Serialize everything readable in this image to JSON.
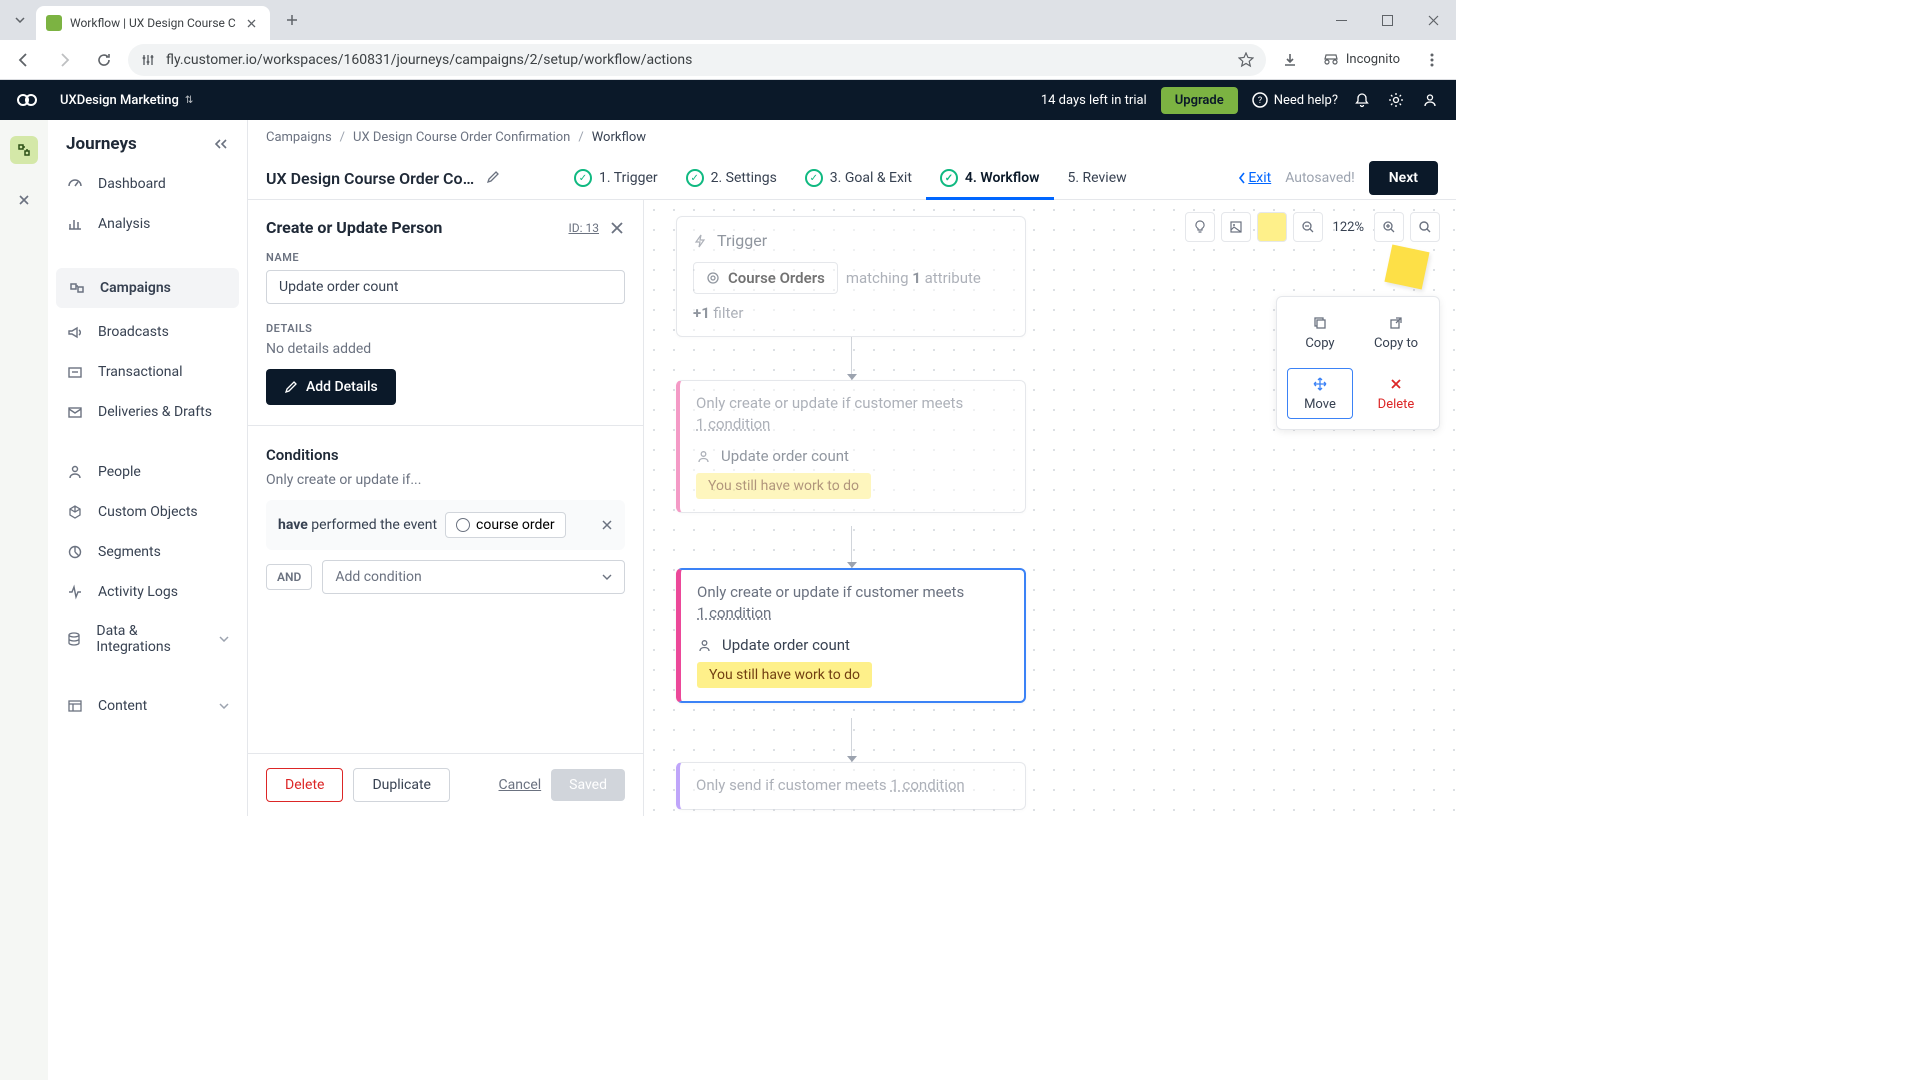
{
  "browser": {
    "tab_title": "Workflow | UX Design Course C",
    "url": "fly.customer.io/workspaces/160831/journeys/campaigns/2/setup/workflow/actions",
    "incognito": "Incognito"
  },
  "header": {
    "workspace": "UXDesign Marketing",
    "trial": "14 days left in trial",
    "upgrade": "Upgrade",
    "help": "Need help?"
  },
  "sidebar": {
    "title": "Journeys",
    "items": [
      "Dashboard",
      "Analysis",
      "Campaigns",
      "Broadcasts",
      "Transactional",
      "Deliveries & Drafts",
      "People",
      "Custom Objects",
      "Segments",
      "Activity Logs",
      "Data & Integrations",
      "Content"
    ]
  },
  "breadcrumb": {
    "a": "Campaigns",
    "b": "UX Design Course Order Confirmation",
    "c": "Workflow"
  },
  "workflow": {
    "title": "UX Design Course Order Confir…",
    "steps": [
      "1. Trigger",
      "2. Settings",
      "3. Goal & Exit",
      "4. Workflow",
      "5. Review"
    ],
    "exit": "Exit",
    "autosaved": "Autosaved!",
    "next": "Next"
  },
  "panel": {
    "title": "Create or Update Person",
    "id": "ID: 13",
    "name_label": "NAME",
    "name_value": "Update order count",
    "details_label": "DETAILS",
    "details_text": "No details added",
    "add_details": "Add Details",
    "conditions_title": "Conditions",
    "conditions_subtitle": "Only create or update if...",
    "have": "have",
    "performed": "performed the event",
    "event_name": "course order",
    "and": "AND",
    "add_condition": "Add condition",
    "delete": "Delete",
    "duplicate": "Duplicate",
    "cancel": "Cancel",
    "saved": "Saved"
  },
  "canvas": {
    "zoom": "122%",
    "actions": {
      "copy": "Copy",
      "copy_to": "Copy to",
      "move": "Move",
      "delete": "Delete"
    },
    "trigger": {
      "label": "Trigger",
      "segment": "Course Orders",
      "matching": "matching",
      "attr_count": "1",
      "attr_word": "attribute",
      "filter_prefix": "+",
      "filter_count": "1",
      "filter_word": "filter"
    },
    "node": {
      "cond1": "Only create or update if customer meets",
      "cond2": "1 condition",
      "action_name": "Update order count",
      "badge": "You still have work to do",
      "send_cond": "Only send if customer meets",
      "send_cond2": "1 condition"
    }
  }
}
